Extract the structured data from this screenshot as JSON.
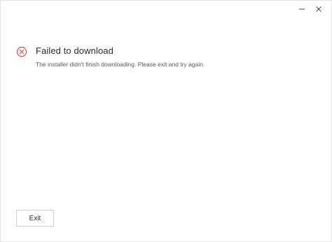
{
  "window": {
    "controls": {
      "minimize_icon": "minimize-icon",
      "close_icon": "close-icon"
    }
  },
  "error": {
    "icon": "error-circle-x-icon",
    "icon_color": "#d9534f",
    "title": "Failed to download",
    "message": "The installer didn't finish downloading. Please exit and try again."
  },
  "footer": {
    "exit_label": "Exit"
  }
}
